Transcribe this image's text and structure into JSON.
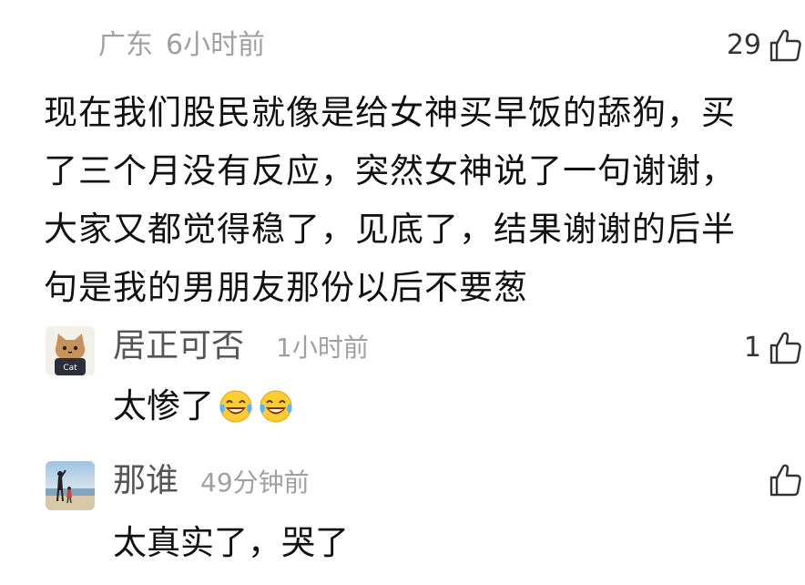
{
  "post": {
    "location": "广东",
    "time": "6小时前",
    "likes": "29",
    "lines": [
      "现在我们股民就像是给女神买早饭的舔狗，买",
      "了三个月没有反应，突然女神说了一句谢谢，",
      "大家又都觉得稳了，见底了，结果谢谢的后半",
      "句是我的男朋友那份以后不要葱"
    ]
  },
  "replies": [
    {
      "username": "居正可否",
      "time": "1小时前",
      "likes": "1",
      "text": "太惨了",
      "avatar_text": "Cat",
      "emojis": [
        "laughing-tears-emoji",
        "laughing-tears-emoji"
      ]
    },
    {
      "username": "那谁",
      "time": "49分钟前",
      "likes": "",
      "text": "太真实了，哭了"
    }
  ],
  "colors": {
    "meta": "#a0a0a0",
    "username": "#555555",
    "text": "#111111"
  }
}
